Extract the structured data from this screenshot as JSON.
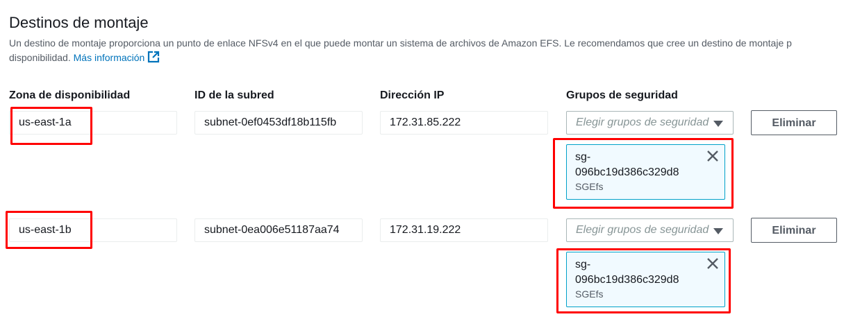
{
  "section": {
    "title": "Destinos de montaje",
    "description_line1": "Un destino de montaje proporciona un punto de enlace NFSv4 en el que puede montar un sistema de archivos de Amazon EFS. Le recomendamos que cree un destino de montaje p",
    "description_line2": "disponibilidad.",
    "learn_more_link": "Más información",
    "link_icon": "external-link-icon"
  },
  "columns": {
    "az": "Zona de disponibilidad",
    "subnet": "ID de la subred",
    "ip": "Dirección IP",
    "sg": "Grupos de seguridad"
  },
  "rows": [
    {
      "az": "us-east-1a",
      "subnet": "subnet-0ef0453df18b115fb",
      "ip": "172.31.85.222",
      "sg_placeholder": "Elegir grupos de seguridad",
      "remove_label": "Eliminar",
      "token": {
        "line1": "sg-",
        "line2": "096bc19d386c329d8",
        "name": "SGEfs"
      }
    },
    {
      "az": "us-east-1b",
      "subnet": "subnet-0ea006e51187aa74",
      "ip": "172.31.19.222",
      "sg_placeholder": "Elegir grupos de seguridad",
      "remove_label": "Eliminar",
      "token": {
        "line1": "sg-",
        "line2": "096bc19d386c329d8",
        "name": "SGEfs"
      }
    }
  ],
  "colors": {
    "link": "#0073bb",
    "annotation": "#ff0000",
    "token_border": "#00a1c9",
    "token_bg": "#f1faff"
  }
}
